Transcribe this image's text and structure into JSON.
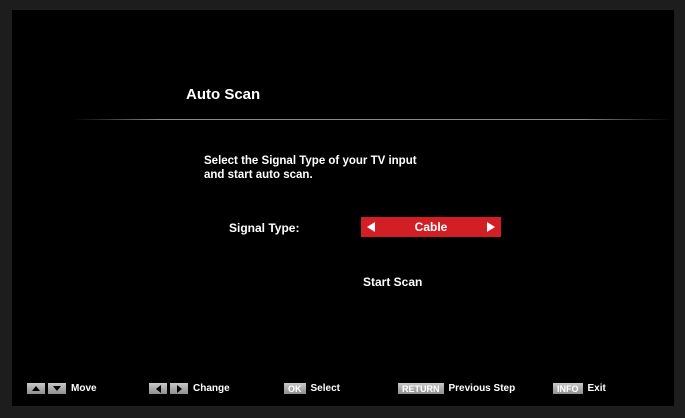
{
  "menu": {
    "title": "Auto Scan",
    "instruction_line1": "Select the Signal Type of your TV input",
    "instruction_line2": "and start auto scan.",
    "signal_type_label": "Signal Type:",
    "signal_type_value": "Cable",
    "start_scan_label": "Start Scan",
    "accent_color": "#d21f26"
  },
  "hints": {
    "move": {
      "keys": [
        "up-arrow-icon",
        "down-arrow-icon"
      ],
      "label": "Move"
    },
    "change": {
      "keys": [
        "left-arrow-icon",
        "right-arrow-icon"
      ],
      "label": "Change"
    },
    "select": {
      "key": "OK",
      "label": "Select"
    },
    "previous": {
      "key": "RETURN",
      "label": "Previous Step"
    },
    "exit": {
      "key": "INFO",
      "label": "Exit"
    }
  }
}
